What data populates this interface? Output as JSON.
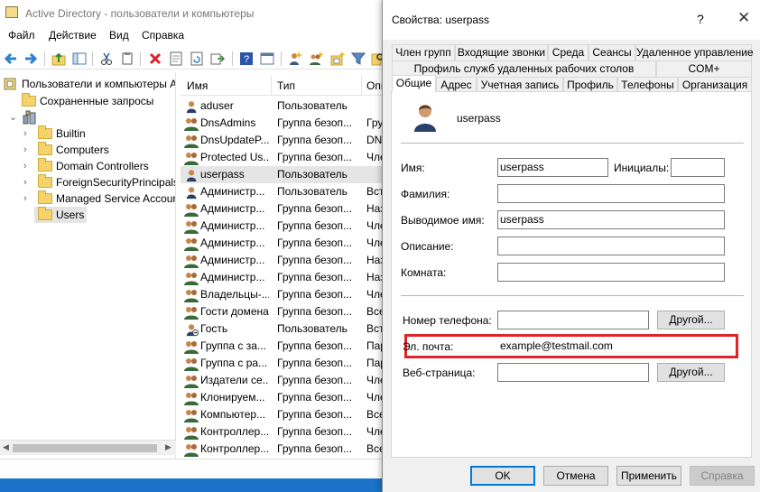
{
  "main_window": {
    "title": "Active Directory - пользователи и компьютеры",
    "menu": [
      "Файл",
      "Действие",
      "Вид",
      "Справка"
    ],
    "toolbar_icons": [
      "back-arrow-icon",
      "forward-arrow-icon",
      "up-folder-icon",
      "show-tree-icon",
      "cut-icon",
      "copy-icon",
      "delete-icon",
      "properties-icon",
      "refresh-icon",
      "export-icon",
      "help-icon",
      "console-view-icon",
      "new-user-icon",
      "new-group-icon",
      "new-ou-icon",
      "filter-icon",
      "find-icon"
    ],
    "tree": {
      "root": "Пользователи и компьютеры А",
      "saved_queries": "Сохраненные запросы",
      "domain_items": [
        "Builtin",
        "Computers",
        "Domain Controllers",
        "ForeignSecurityPrincipals",
        "Managed Service Accour",
        "Users"
      ]
    },
    "list": {
      "columns": [
        "Имя",
        "Тип",
        "Опи"
      ],
      "rows": [
        {
          "icon": "user",
          "name": "aduser",
          "type": "Пользователь",
          "desc": ""
        },
        {
          "icon": "group",
          "name": "DnsAdmins",
          "type": "Группа безоп...",
          "desc": "Гру"
        },
        {
          "icon": "group",
          "name": "DnsUpdateP...",
          "type": "Группа безоп...",
          "desc": "DNS"
        },
        {
          "icon": "group",
          "name": "Protected Us...",
          "type": "Группа безоп...",
          "desc": "Чле"
        },
        {
          "icon": "user",
          "name": "userpass",
          "type": "Пользователь",
          "desc": ""
        },
        {
          "icon": "user",
          "name": "Администр...",
          "type": "Пользователь",
          "desc": "Вст"
        },
        {
          "icon": "group",
          "name": "Администр...",
          "type": "Группа безоп...",
          "desc": "Наз"
        },
        {
          "icon": "group",
          "name": "Администр...",
          "type": "Группа безоп...",
          "desc": "Чле"
        },
        {
          "icon": "group",
          "name": "Администр...",
          "type": "Группа безоп...",
          "desc": "Чле"
        },
        {
          "icon": "group",
          "name": "Администр...",
          "type": "Группа безоп...",
          "desc": "Наз"
        },
        {
          "icon": "group",
          "name": "Администр...",
          "type": "Группа безоп...",
          "desc": "Наз"
        },
        {
          "icon": "group",
          "name": "Владельцы-...",
          "type": "Группа безоп...",
          "desc": "Чле"
        },
        {
          "icon": "group",
          "name": "Гости домена",
          "type": "Группа безоп...",
          "desc": "Все"
        },
        {
          "icon": "user-disabled",
          "name": "Гость",
          "type": "Пользователь",
          "desc": "Вст"
        },
        {
          "icon": "group",
          "name": "Группа с за...",
          "type": "Группа безоп...",
          "desc": "Пар"
        },
        {
          "icon": "group",
          "name": "Группа с ра...",
          "type": "Группа безоп...",
          "desc": "Пар"
        },
        {
          "icon": "group",
          "name": "Издатели се...",
          "type": "Группа безоп...",
          "desc": "Чле"
        },
        {
          "icon": "group",
          "name": "Клонируем...",
          "type": "Группа безоп...",
          "desc": "Чле"
        },
        {
          "icon": "group",
          "name": "Компьютер...",
          "type": "Группа безоп...",
          "desc": "Все"
        },
        {
          "icon": "group",
          "name": "Контроллер...",
          "type": "Группа безоп...",
          "desc": "Чле"
        },
        {
          "icon": "group",
          "name": "Контроллер...",
          "type": "Группа безоп...",
          "desc": "Все"
        }
      ]
    }
  },
  "dialog": {
    "title": "Свойства: userpass",
    "help_glyph": "?",
    "close_glyph": "✕",
    "tabs_row1": [
      "Член групп",
      "Входящие звонки",
      "Среда",
      "Сеансы",
      "Удаленное управление"
    ],
    "tabs_row2": [
      "Профиль служб удаленных рабочих столов",
      "COM+"
    ],
    "tabs_row3": [
      "Общие",
      "Адрес",
      "Учетная запись",
      "Профиль",
      "Телефоны",
      "Организация"
    ],
    "account_name": "userpass",
    "fields": {
      "first_name_label": "Имя:",
      "first_name": "userpass",
      "initials_label": "Инициалы:",
      "initials": "",
      "last_name_label": "Фамилия:",
      "last_name": "",
      "display_name_label": "Выводимое имя:",
      "display_name": "userpass",
      "description_label": "Описание:",
      "description": "",
      "office_label": "Комната:",
      "office": "",
      "phone_label": "Номер телефона:",
      "phone": "",
      "email_label": "Эл. почта:",
      "email": "example@testmail.com",
      "web_label": "Веб-страница:",
      "web": "",
      "other_button": "Другой..."
    },
    "buttons": {
      "ok": "OK",
      "cancel": "Отмена",
      "apply": "Применить",
      "help": "Справка"
    }
  }
}
